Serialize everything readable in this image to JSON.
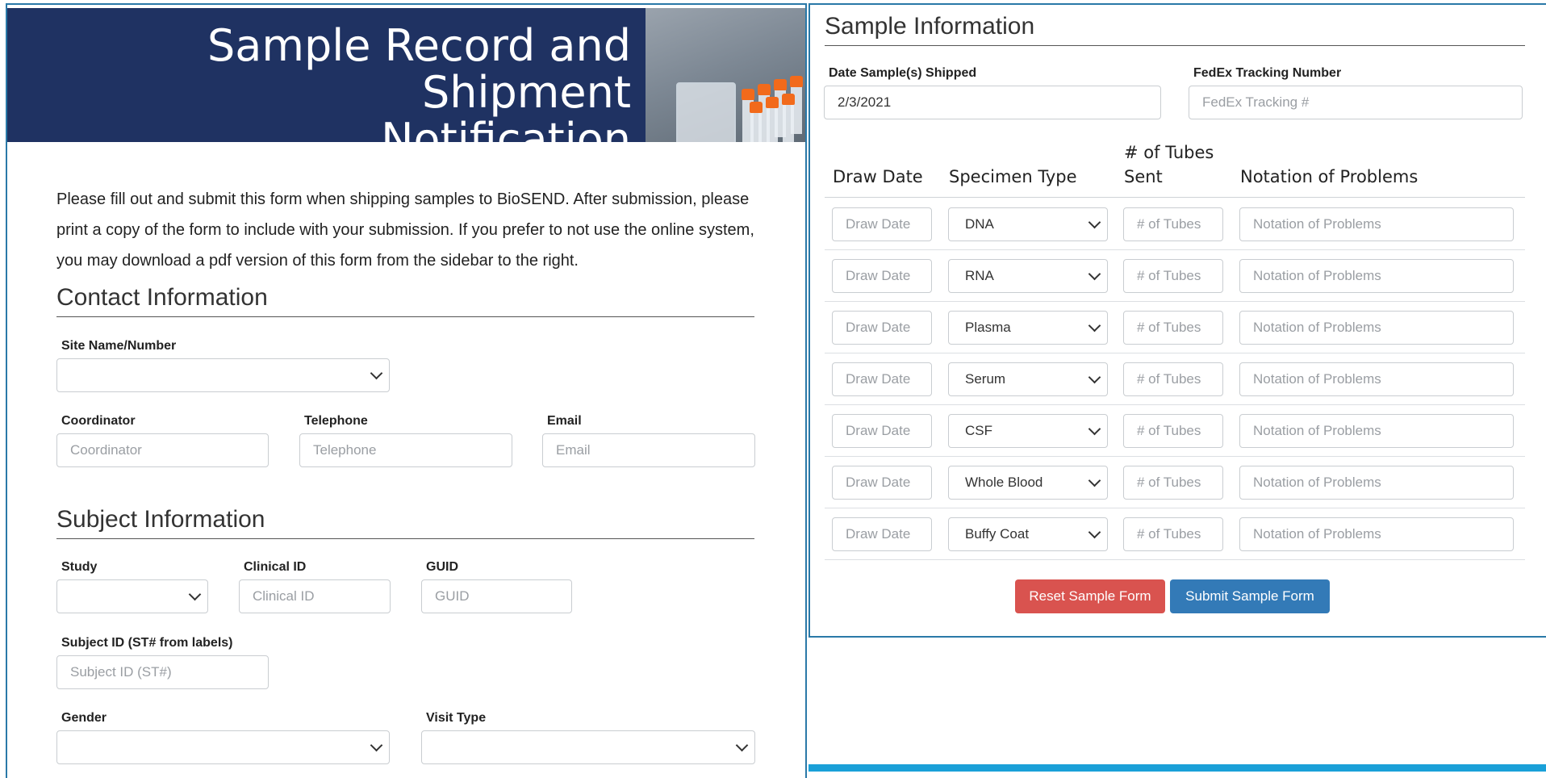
{
  "banner": {
    "title": "Sample Record and Shipment\nNotification"
  },
  "intro": {
    "text": "Please fill out and submit this form when shipping samples to BioSEND. After submission, please print a copy of the form to include with your submission. If you prefer to not use the online system, you may download a pdf version of this form from the sidebar to the right."
  },
  "contact": {
    "title": "Contact Information",
    "site_label": "Site Name/Number",
    "site_value": "",
    "coordinator_label": "Coordinator",
    "coordinator_placeholder": "Coordinator",
    "telephone_label": "Telephone",
    "telephone_placeholder": "Telephone",
    "email_label": "Email",
    "email_placeholder": "Email"
  },
  "subject": {
    "title": "Subject Information",
    "study_label": "Study",
    "study_value": "",
    "clinical_id_label": "Clinical ID",
    "clinical_id_placeholder": "Clinical ID",
    "guid_label": "GUID",
    "guid_placeholder": "GUID",
    "subject_id_label": "Subject ID (ST# from labels)",
    "subject_id_placeholder": "Subject ID (ST#)",
    "gender_label": "Gender",
    "gender_value": "",
    "visit_type_label": "Visit Type",
    "visit_type_value": ""
  },
  "sample": {
    "title": "Sample Information",
    "date_shipped_label": "Date Sample(s) Shipped",
    "date_shipped_value": "2/3/2021",
    "fedex_label": "FedEx Tracking Number",
    "fedex_placeholder": "FedEx Tracking #",
    "headers": {
      "draw_date": "Draw Date",
      "specimen_type": "Specimen Type",
      "tubes_sent": "# of Tubes\nSent",
      "problems": "Notation of Problems"
    },
    "rows": [
      {
        "draw_placeholder": "Draw Date",
        "specimen": "DNA",
        "tubes_placeholder": "# of Tubes",
        "problems_placeholder": "Notation of Problems"
      },
      {
        "draw_placeholder": "Draw Date",
        "specimen": "RNA",
        "tubes_placeholder": "# of Tubes",
        "problems_placeholder": "Notation of Problems"
      },
      {
        "draw_placeholder": "Draw Date",
        "specimen": "Plasma",
        "tubes_placeholder": "# of Tubes",
        "problems_placeholder": "Notation of Problems"
      },
      {
        "draw_placeholder": "Draw Date",
        "specimen": "Serum",
        "tubes_placeholder": "# of Tubes",
        "problems_placeholder": "Notation of Problems"
      },
      {
        "draw_placeholder": "Draw Date",
        "specimen": "CSF",
        "tubes_placeholder": "# of Tubes",
        "problems_placeholder": "Notation of Problems"
      },
      {
        "draw_placeholder": "Draw Date",
        "specimen": "Whole Blood",
        "tubes_placeholder": "# of Tubes",
        "problems_placeholder": "Notation of Problems"
      },
      {
        "draw_placeholder": "Draw Date",
        "specimen": "Buffy Coat",
        "tubes_placeholder": "# of Tubes",
        "problems_placeholder": "Notation of Problems"
      }
    ],
    "reset_label": "Reset Sample Form",
    "submit_label": "Submit Sample Form"
  },
  "colors": {
    "banner_bg": "#1f3262",
    "panel_border": "#2a79a8",
    "reset_button": "#d9534f",
    "submit_button": "#337ab7",
    "bottom_bar": "#1aa0d8"
  }
}
